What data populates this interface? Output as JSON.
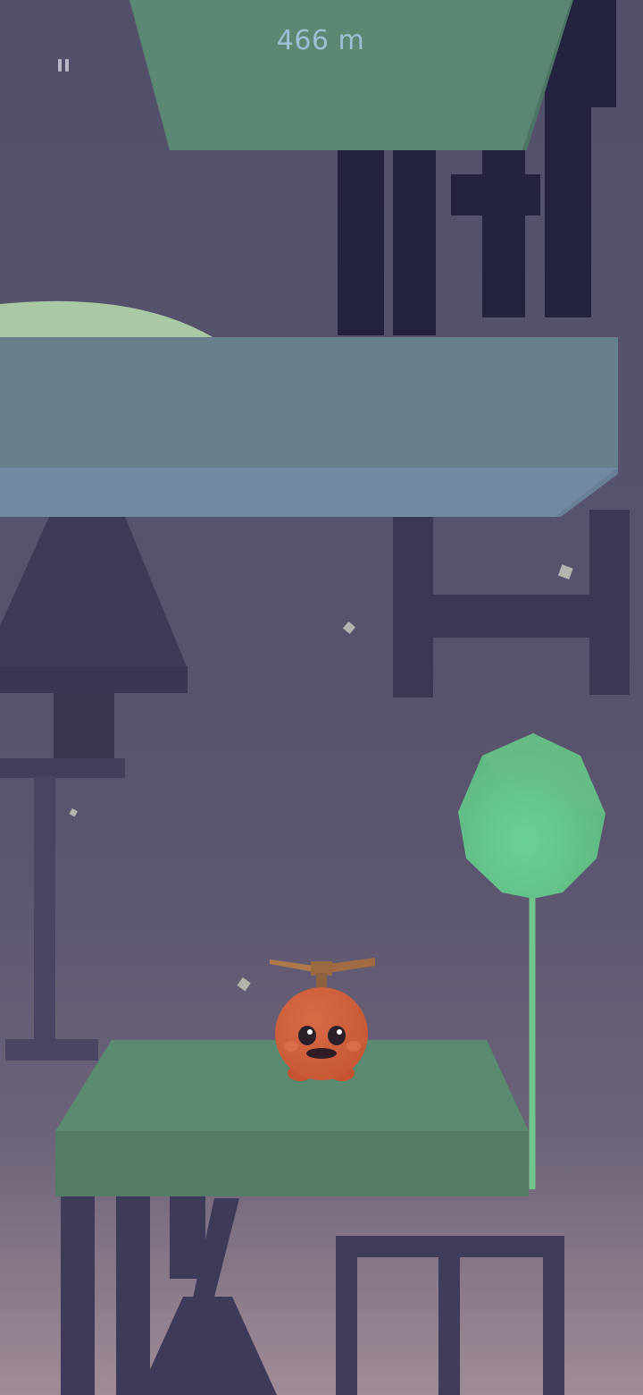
{
  "hud": {
    "distance_text": "466 m",
    "pause_icon": "pause-icon"
  },
  "colors": {
    "sky_top": "#53506b",
    "sky_bottom": "#9e8a96",
    "platform_green_top": "#5b8a72",
    "platform_green_front": "#54796a",
    "platform_blue_top": "#68808a",
    "platform_blue_front": "#7189a3",
    "silhouette_dark": "#222240",
    "silhouette_mid": "#3e3a58",
    "balloon": "#65c48a",
    "character": "#d1603d"
  },
  "scene": {
    "character": "orange-propeller-blob",
    "balloon": "green-balloon",
    "background_objects": [
      "chair-silhouette",
      "lamp-silhouette",
      "window-frame-silhouette"
    ]
  }
}
